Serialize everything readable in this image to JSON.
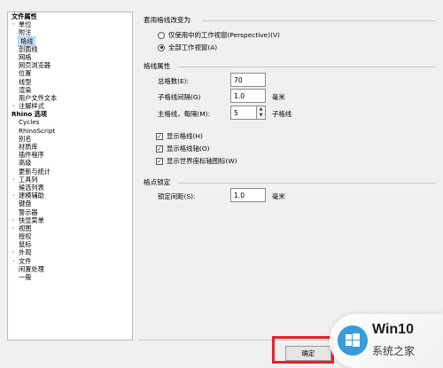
{
  "tree": {
    "items": [
      {
        "label": "文件属性",
        "type": "root",
        "expander": ""
      },
      {
        "label": "单位",
        "type": "child",
        "expander": "›"
      },
      {
        "label": "附注",
        "type": "child",
        "expander": ""
      },
      {
        "label": "格线",
        "type": "child",
        "expander": "",
        "selected": true
      },
      {
        "label": "剖面线",
        "type": "child",
        "expander": ""
      },
      {
        "label": "网格",
        "type": "child",
        "expander": ""
      },
      {
        "label": "网页浏览器",
        "type": "child",
        "expander": ""
      },
      {
        "label": "位置",
        "type": "child",
        "expander": ""
      },
      {
        "label": "线型",
        "type": "child",
        "expander": ""
      },
      {
        "label": "渲染",
        "type": "child",
        "expander": ""
      },
      {
        "label": "用户文件文本",
        "type": "child",
        "expander": ""
      },
      {
        "label": "注解样式",
        "type": "child",
        "expander": "›"
      },
      {
        "label": "Rhino 选项",
        "type": "root",
        "expander": ""
      },
      {
        "label": "Cycles",
        "type": "child",
        "expander": ""
      },
      {
        "label": "RhinoScript",
        "type": "child",
        "expander": ""
      },
      {
        "label": "别名",
        "type": "child",
        "expander": ""
      },
      {
        "label": "材质库",
        "type": "child",
        "expander": ""
      },
      {
        "label": "插件程序",
        "type": "child",
        "expander": ""
      },
      {
        "label": "高级",
        "type": "child",
        "expander": ""
      },
      {
        "label": "更新与统计",
        "type": "child",
        "expander": ""
      },
      {
        "label": "工具列",
        "type": "child",
        "expander": "›"
      },
      {
        "label": "候选列表",
        "type": "child",
        "expander": ""
      },
      {
        "label": "建模辅助",
        "type": "child",
        "expander": "›"
      },
      {
        "label": "键盘",
        "type": "child",
        "expander": ""
      },
      {
        "label": "警示器",
        "type": "child",
        "expander": ""
      },
      {
        "label": "快显菜单",
        "type": "child",
        "expander": "›"
      },
      {
        "label": "视图",
        "type": "child",
        "expander": "›"
      },
      {
        "label": "授权",
        "type": "child",
        "expander": ""
      },
      {
        "label": "鼠标",
        "type": "child",
        "expander": ""
      },
      {
        "label": "外观",
        "type": "child",
        "expander": "›"
      },
      {
        "label": "文件",
        "type": "child",
        "expander": "›"
      },
      {
        "label": "闲置处理",
        "type": "child",
        "expander": ""
      },
      {
        "label": "一般",
        "type": "child",
        "expander": ""
      }
    ]
  },
  "apply_section": {
    "title": "套用格线改变为",
    "option_active": "仅使用中的工作视窗(Perspective)(V)",
    "option_all": "全部工作视窗(A)",
    "selected": "all"
  },
  "grid_section": {
    "title": "格线属性",
    "total_label": "总格数(E):",
    "total_value": "70",
    "spacing_label": "子格线间隔(G)",
    "spacing_value": "1.0",
    "spacing_unit": "毫米",
    "major_label": "主格线，每隔(M):",
    "major_value": "5",
    "major_unit": "子格线",
    "spin_up": "▲",
    "spin_down": "▼",
    "check_mark": "✓",
    "show_grid": "显示格线(H)",
    "show_axes": "显示格线轴(O)",
    "show_world_axes": "显示世界座标轴图标(W)",
    "show_grid_checked": true,
    "show_axes_checked": true,
    "show_world_axes_checked": true
  },
  "snap_section": {
    "title": "格点锁定",
    "spacing_label": "锁定间距(S):",
    "spacing_value": "1.0",
    "spacing_unit": "毫米"
  },
  "footer": {
    "ok_label": "确定"
  },
  "watermark": {
    "title": "Win10",
    "subtitle": "系统之家"
  },
  "colors": {
    "selection": "#cce8ff",
    "highlight": "#e6212a",
    "logo": "#3a9bd8"
  }
}
